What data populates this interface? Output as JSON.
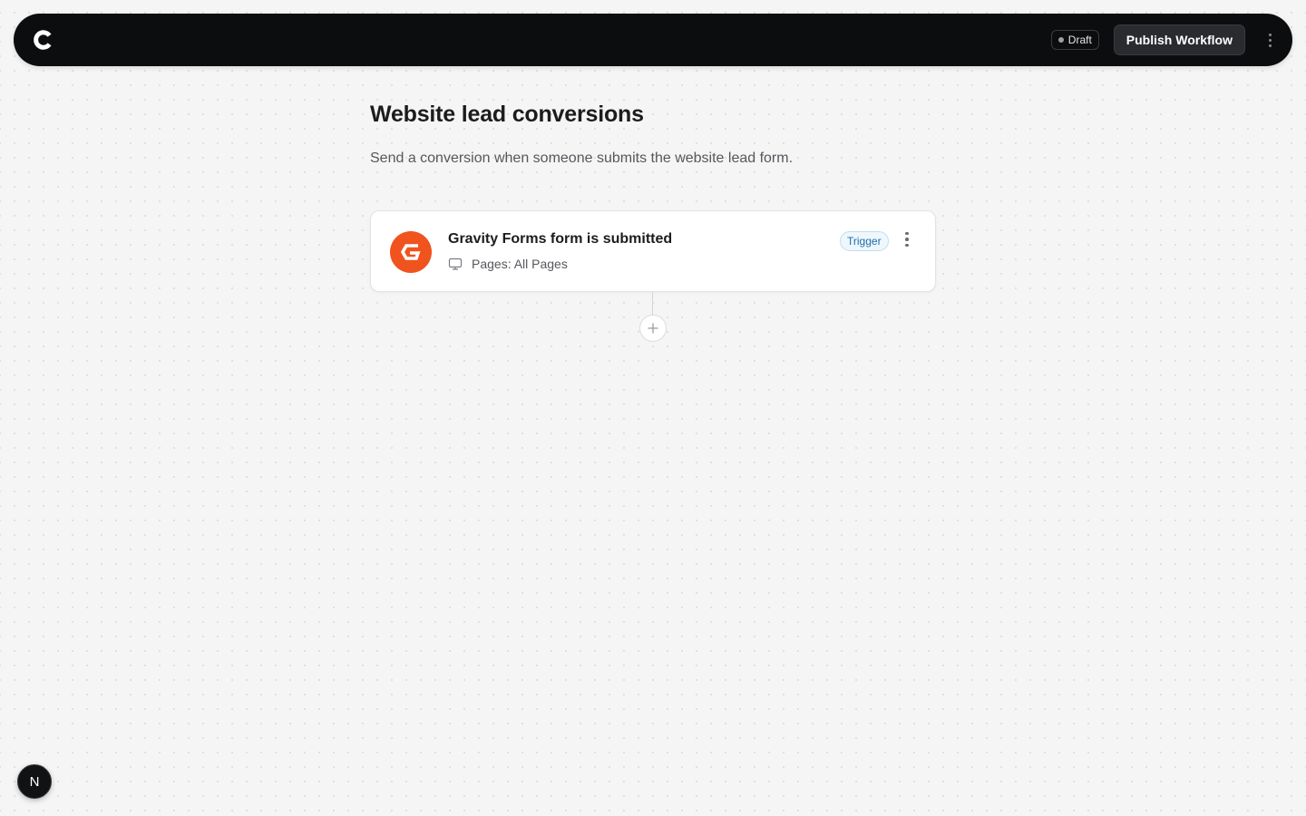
{
  "header": {
    "logo_icon": "c-logo-icon",
    "status_badge": "Draft",
    "publish_label": "Publish Workflow",
    "more_icon": "kebab-vertical-icon"
  },
  "workflow": {
    "title": "Website lead conversions",
    "description": "Send a conversion when someone submits the website lead form."
  },
  "trigger_card": {
    "app_icon": "gravity-forms-icon",
    "app_color": "#f0531d",
    "title": "Gravity Forms form is submitted",
    "meta_icon": "monitor-icon",
    "meta_text": "Pages: All Pages",
    "badge": "Trigger",
    "more_icon": "kebab-vertical-icon"
  },
  "add_step": {
    "icon": "plus-icon"
  },
  "dev_badge": {
    "label": "N"
  },
  "colors": {
    "topbar_bg": "#0c0d0f",
    "page_bg": "#f5f5f5",
    "trigger_badge_text": "#1f6fa6",
    "trigger_badge_bg": "#eef7fc"
  }
}
